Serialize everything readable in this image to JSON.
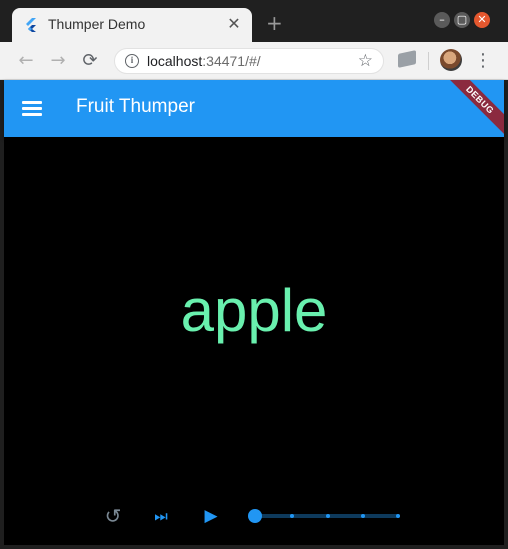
{
  "browser": {
    "tab_title": "Thumper Demo",
    "tab_close_glyph": "✕",
    "new_tab_glyph": "+",
    "url_host": "localhost",
    "url_rest": ":34471/#/",
    "back_glyph": "←",
    "forward_glyph": "→",
    "reload_glyph": "⟳",
    "star_glyph": "☆",
    "menu_glyph": "⋮",
    "info_glyph": "i",
    "window_controls": {
      "minimize": "–",
      "maximize": "▢",
      "close": "✕"
    }
  },
  "app": {
    "title": "Fruit Thumper",
    "debug_banner": "DEBUG",
    "word": "apple",
    "colors": {
      "appbar": "#2196f3",
      "word": "#69f0ae",
      "accent": "#2196f3",
      "debug": "#8b2a3f"
    }
  },
  "controls": {
    "replay_glyph": "↺",
    "skip_glyph": "⏭",
    "play_glyph": "▶",
    "slider": {
      "value": 0,
      "min": 0,
      "max": 4,
      "divisions": 4
    }
  }
}
